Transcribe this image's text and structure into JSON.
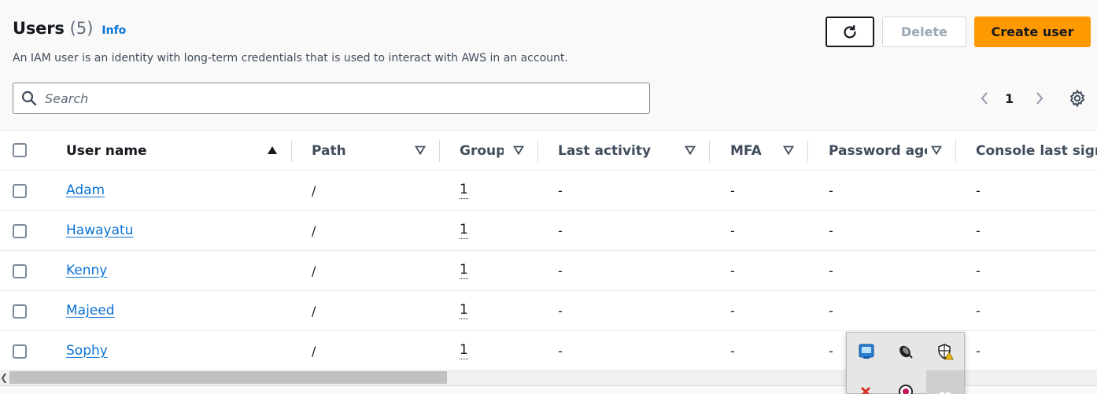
{
  "header": {
    "title": "Users",
    "count": "(5)",
    "info_label": "Info",
    "description": "An IAM user is an identity with long-term credentials that is used to interact with AWS in an account."
  },
  "actions": {
    "refresh_icon": "refresh-icon",
    "delete_label": "Delete",
    "create_label": "Create user"
  },
  "search": {
    "placeholder": "Search",
    "value": ""
  },
  "pagination": {
    "current_page": "1"
  },
  "table": {
    "columns": [
      {
        "label": "User name",
        "sort": "ascending"
      },
      {
        "label": "Path",
        "sort": "none"
      },
      {
        "label": "Groups",
        "sort": "none"
      },
      {
        "label": "Last activity",
        "sort": "none"
      },
      {
        "label": "MFA",
        "sort": "none"
      },
      {
        "label": "Password age",
        "sort": "none"
      },
      {
        "label": "Console last sign-in",
        "sort": "none"
      }
    ],
    "rows": [
      {
        "user_name": "Adam",
        "path": "/",
        "groups": "1",
        "last_activity": "-",
        "mfa": "-",
        "password_age": "-",
        "console_last_signin": "-"
      },
      {
        "user_name": "Hawayatu",
        "path": "/",
        "groups": "1",
        "last_activity": "-",
        "mfa": "-",
        "password_age": "-",
        "console_last_signin": "-"
      },
      {
        "user_name": "Kenny",
        "path": "/",
        "groups": "1",
        "last_activity": "-",
        "mfa": "-",
        "password_age": "-",
        "console_last_signin": "-"
      },
      {
        "user_name": "Majeed",
        "path": "/",
        "groups": "1",
        "last_activity": "-",
        "mfa": "-",
        "password_age": "-",
        "console_last_signin": "-"
      },
      {
        "user_name": "Sophy",
        "path": "/",
        "groups": "1",
        "last_activity": "-",
        "mfa": "-",
        "password_age": "-",
        "console_last_signin": "-"
      }
    ]
  },
  "colors": {
    "accent": "#ff9900",
    "link": "#0972d3",
    "text": "#16191f",
    "muted": "#5f6b7a",
    "disabled": "#9ba7b6"
  },
  "tray_icons": [
    "intel-graphics-icon",
    "satellite-dish-icon",
    "security-shield-warning-icon",
    "red-x-icon",
    "badge-icon",
    "windows-icon"
  ]
}
